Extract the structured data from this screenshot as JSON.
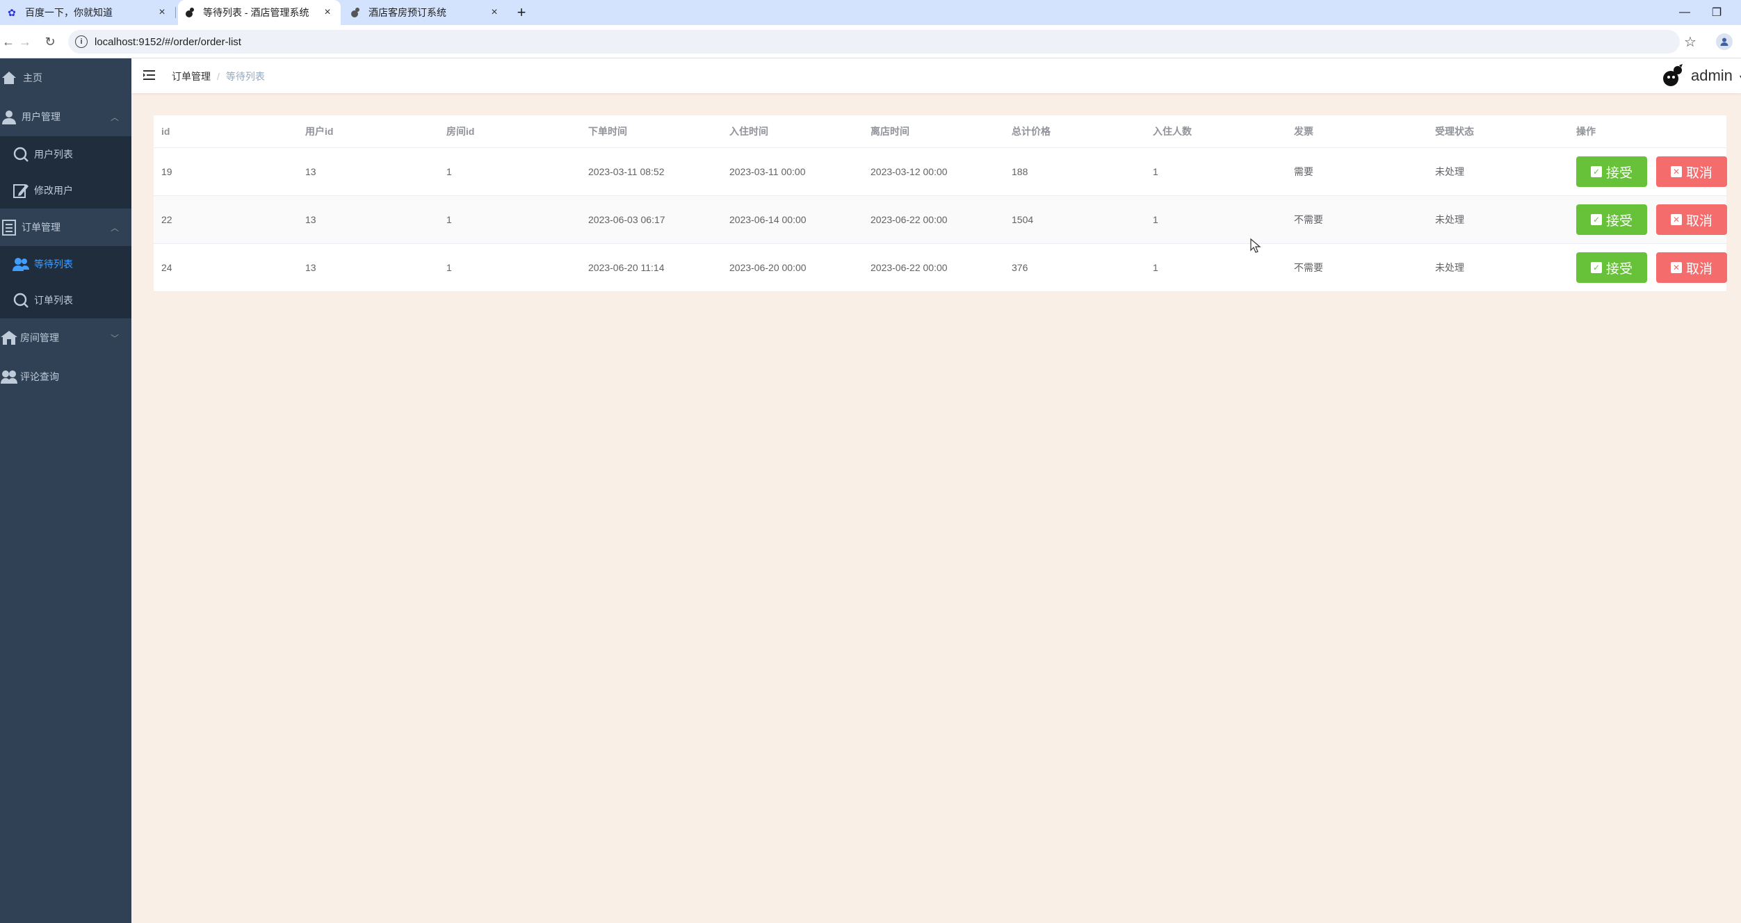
{
  "browser": {
    "tabs": [
      {
        "title": "百度一下，你就知道",
        "favicon": "baidu-paw-icon",
        "active": false
      },
      {
        "title": "等待列表 - 酒店管理系统",
        "favicon": "bird-logo-icon",
        "active": true
      },
      {
        "title": "酒店客房预订系统",
        "favicon": "bird-logo-icon",
        "active": false
      }
    ],
    "url": "localhost:9152/#/order/order-list"
  },
  "sidebar": {
    "items": [
      {
        "label": "主页",
        "icon": "home-icon"
      },
      {
        "label": "用户管理",
        "icon": "user-icon",
        "expanded": true
      },
      {
        "label": "用户列表",
        "icon": "search-icon",
        "sub": true
      },
      {
        "label": "修改用户",
        "icon": "edit-icon",
        "sub": true
      },
      {
        "label": "订单管理",
        "icon": "list-icon",
        "expanded": true
      },
      {
        "label": "等待列表",
        "icon": "peoples-icon",
        "sub": true,
        "active": true
      },
      {
        "label": "订单列表",
        "icon": "search-icon",
        "sub": true
      },
      {
        "label": "房间管理",
        "icon": "building-icon",
        "expanded": false
      },
      {
        "label": "评论查询",
        "icon": "comment-icon"
      }
    ]
  },
  "navbar": {
    "breadcrumb": [
      "订单管理",
      "等待列表"
    ],
    "username": "admin"
  },
  "table": {
    "columns": [
      "id",
      "用户id",
      "房间id",
      "下单时间",
      "入住时间",
      "离店时间",
      "总计价格",
      "入住人数",
      "发票",
      "受理状态",
      "操作"
    ],
    "rows": [
      {
        "id": "19",
        "user_id": "13",
        "room_id": "1",
        "order_time": "2023-03-11 08:52",
        "checkin": "2023-03-11 00:00",
        "checkout": "2023-03-12 00:00",
        "price": "188",
        "guests": "1",
        "invoice": "需要",
        "status": "未处理"
      },
      {
        "id": "22",
        "user_id": "13",
        "room_id": "1",
        "order_time": "2023-06-03 06:17",
        "checkin": "2023-06-14 00:00",
        "checkout": "2023-06-22 00:00",
        "price": "1504",
        "guests": "1",
        "invoice": "不需要",
        "status": "未处理"
      },
      {
        "id": "24",
        "user_id": "13",
        "room_id": "1",
        "order_time": "2023-06-20 11:14",
        "checkin": "2023-06-20 00:00",
        "checkout": "2023-06-22 00:00",
        "price": "376",
        "guests": "1",
        "invoice": "不需要",
        "status": "未处理"
      }
    ],
    "accept_label": "接受",
    "cancel_label": "取消"
  },
  "colors": {
    "sidebar_bg": "#304156",
    "submenu_bg": "#1f2d3d",
    "active": "#409eff",
    "accept": "#67c23a",
    "cancel": "#f56c6c",
    "page_bg": "#faefe6"
  }
}
